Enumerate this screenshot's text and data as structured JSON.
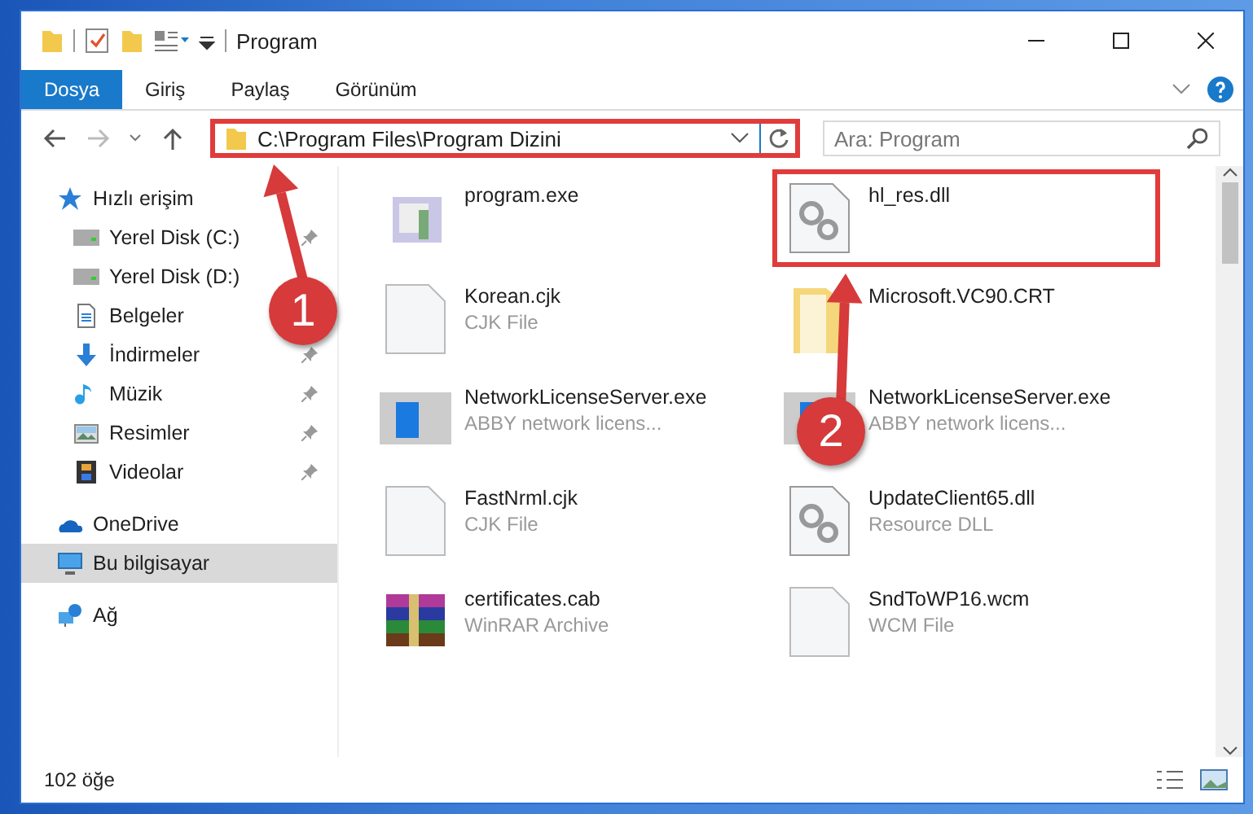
{
  "window": {
    "title": "Program"
  },
  "ribbon_tabs": [
    {
      "label": "Dosya",
      "selected": true
    },
    {
      "label": "Giriş",
      "selected": false
    },
    {
      "label": "Paylaş",
      "selected": false
    },
    {
      "label": "Görünüm",
      "selected": false
    }
  ],
  "address": {
    "path": "C:\\Program Files\\Program Dizini",
    "highlighted": true
  },
  "search": {
    "placeholder": "Ara: Program"
  },
  "nav_items": [
    {
      "label": "Hızlı erişim",
      "kind": "star",
      "pinned": false,
      "selected": false
    },
    {
      "label": "Yerel Disk (C:)",
      "kind": "drive",
      "pinned": true,
      "selected": false
    },
    {
      "label": "Yerel Disk (D:)",
      "kind": "drive",
      "pinned": false,
      "selected": false
    },
    {
      "label": "Belgeler",
      "kind": "docs",
      "pinned": false,
      "selected": false
    },
    {
      "label": "İndirmeler",
      "kind": "download",
      "pinned": true,
      "selected": false
    },
    {
      "label": "Müzik",
      "kind": "music",
      "pinned": true,
      "selected": false
    },
    {
      "label": "Resimler",
      "kind": "pictures",
      "pinned": true,
      "selected": false
    },
    {
      "label": "Videolar",
      "kind": "videos",
      "pinned": true,
      "selected": false
    },
    {
      "label": "OneDrive",
      "kind": "cloud",
      "pinned": false,
      "selected": false
    },
    {
      "label": "Bu bilgisayar",
      "kind": "computer",
      "pinned": false,
      "selected": true
    },
    {
      "label": "Ağ",
      "kind": "network",
      "pinned": false,
      "selected": false
    }
  ],
  "files": [
    {
      "name": "program.exe",
      "kind": "exe",
      "highlighted": false
    },
    {
      "name": "hl_res.dll",
      "kind": "dll",
      "highlighted": true
    },
    {
      "name": "Korean.cjk",
      "type": "CJK File",
      "kind": "blank",
      "highlighted": false
    },
    {
      "name": "Microsoft.VC90.CRT",
      "kind": "folder",
      "highlighted": false
    },
    {
      "name": "NetworkLicenseServer.exe",
      "type": "ABBY network licens...",
      "kind": "app",
      "highlighted": false
    },
    {
      "name": "NetworkLicenseServer.exe",
      "type": "ABBY network licens...",
      "kind": "app",
      "highlighted": false
    },
    {
      "name": "FastNrml.cjk",
      "type": "CJK File",
      "kind": "blank",
      "highlighted": false
    },
    {
      "name": "UpdateClient65.dll",
      "type": "Resource DLL",
      "kind": "dll",
      "highlighted": false
    },
    {
      "name": "certificates.cab",
      "type": "WinRAR Archive",
      "kind": "rar",
      "highlighted": false
    },
    {
      "name": "SndToWP16.wcm",
      "type": "WCM File",
      "kind": "blank",
      "highlighted": false
    }
  ],
  "status_bar": {
    "count": "102 öğe"
  },
  "annotations": [
    {
      "number": "1"
    },
    {
      "number": "2"
    }
  ]
}
